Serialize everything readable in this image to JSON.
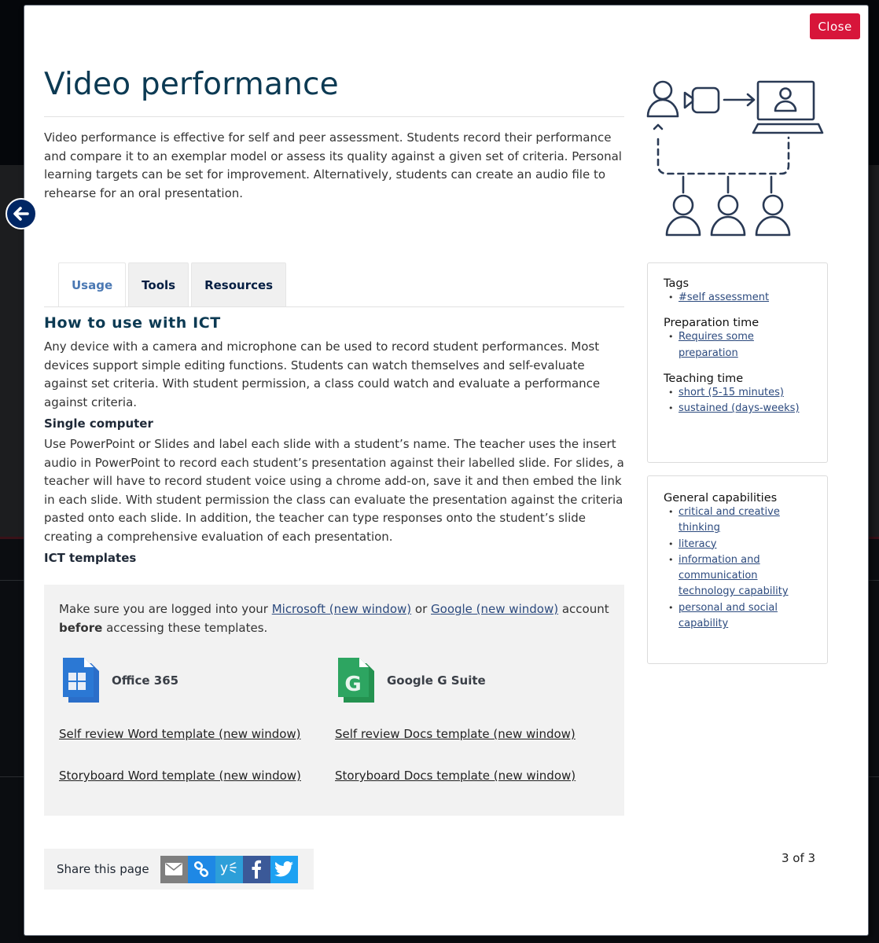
{
  "modal": {
    "close_label": "Close",
    "title": "Video performance",
    "intro": "Video performance is effective for self and peer assessment. Students record their performance and compare it to an exemplar model or assess its quality against a given set of criteria. Personal learning targets can be set for improvement. Alternatively, students can create an audio file to rehearse for an oral presentation.",
    "hero_icon": "video-performance-illustration",
    "prev_icon": "arrow-left-circle-icon"
  },
  "tabs": [
    {
      "label": "Usage",
      "active": true
    },
    {
      "label": "Tools",
      "active": false
    },
    {
      "label": "Resources",
      "active": false
    }
  ],
  "usage": {
    "heading": "How to use with ICT",
    "para1": "Any device with a camera and microphone can be used to record student performances. Most devices support simple editing functions. Students can watch themselves and self-evaluate against set criteria. With student permission, a class could watch and evaluate a performance against criteria.",
    "single_heading": "Single computer",
    "para2": "Use PowerPoint or Slides and label each slide with a student’s name. The teacher uses the insert audio in PowerPoint to record each student’s presentation against their labelled slide. For slides, a teacher will have to record student voice using a chrome add-on, save it and then embed the link in each slide. With student permission the class can evaluate the presentation against the criteria pasted onto each slide. In addition, the teacher can type responses onto the student’s slide creating a comprehensive evaluation of each presentation.",
    "templates_heading": "ICT templates"
  },
  "templates": {
    "note_prefix": "Make sure you are logged into your ",
    "microsoft_link": "Microsoft (new window)",
    "note_or": " or ",
    "google_link": "Google (new window)",
    "note_account": " account ",
    "note_bold": "before",
    "note_suffix": " accessing these templates.",
    "providers": [
      {
        "name": "Office 365",
        "icon": "office-365-doc-icon",
        "color": "#2b78d4",
        "links": [
          "Self review Word template (new window)",
          "Storyboard Word template (new window)"
        ]
      },
      {
        "name": "Google G Suite",
        "icon": "google-gsuite-doc-icon",
        "color": "#2da561",
        "links": [
          "Self review Docs template (new window)",
          "Storyboard Docs template (new window)"
        ]
      }
    ]
  },
  "sidebar": {
    "meta": [
      {
        "heading": "Tags",
        "items": [
          "#self assessment"
        ]
      },
      {
        "heading": "Preparation time",
        "items": [
          "Requires some preparation"
        ]
      },
      {
        "heading": "Teaching time",
        "items": [
          "short (5-15 minutes)",
          "sustained (days-weeks)"
        ]
      }
    ],
    "capabilities": {
      "heading": "General capabilities",
      "items": [
        "critical and creative thinking",
        "literacy",
        "information and communication technology capability",
        "personal and social capability"
      ]
    }
  },
  "share": {
    "label": "Share this page",
    "buttons": [
      {
        "name": "email",
        "icon": "envelope-icon",
        "color": "#7f7f7f"
      },
      {
        "name": "copy-link",
        "icon": "link-icon",
        "color": "#1e88e5"
      },
      {
        "name": "yammer",
        "icon": "yammer-icon",
        "color": "#2d9fd9"
      },
      {
        "name": "facebook",
        "icon": "facebook-icon",
        "color": "#3b5998"
      },
      {
        "name": "twitter",
        "icon": "twitter-icon",
        "color": "#1da1f2"
      }
    ]
  },
  "pager": {
    "text": "3 of 3",
    "current": 3,
    "total": 3
  },
  "colors": {
    "accent_red": "#d7153a",
    "title_navy": "#0c3a53",
    "link_blue": "#2c4a7e",
    "active_tab": "#4a78b3",
    "nav_navy": "#002664"
  }
}
